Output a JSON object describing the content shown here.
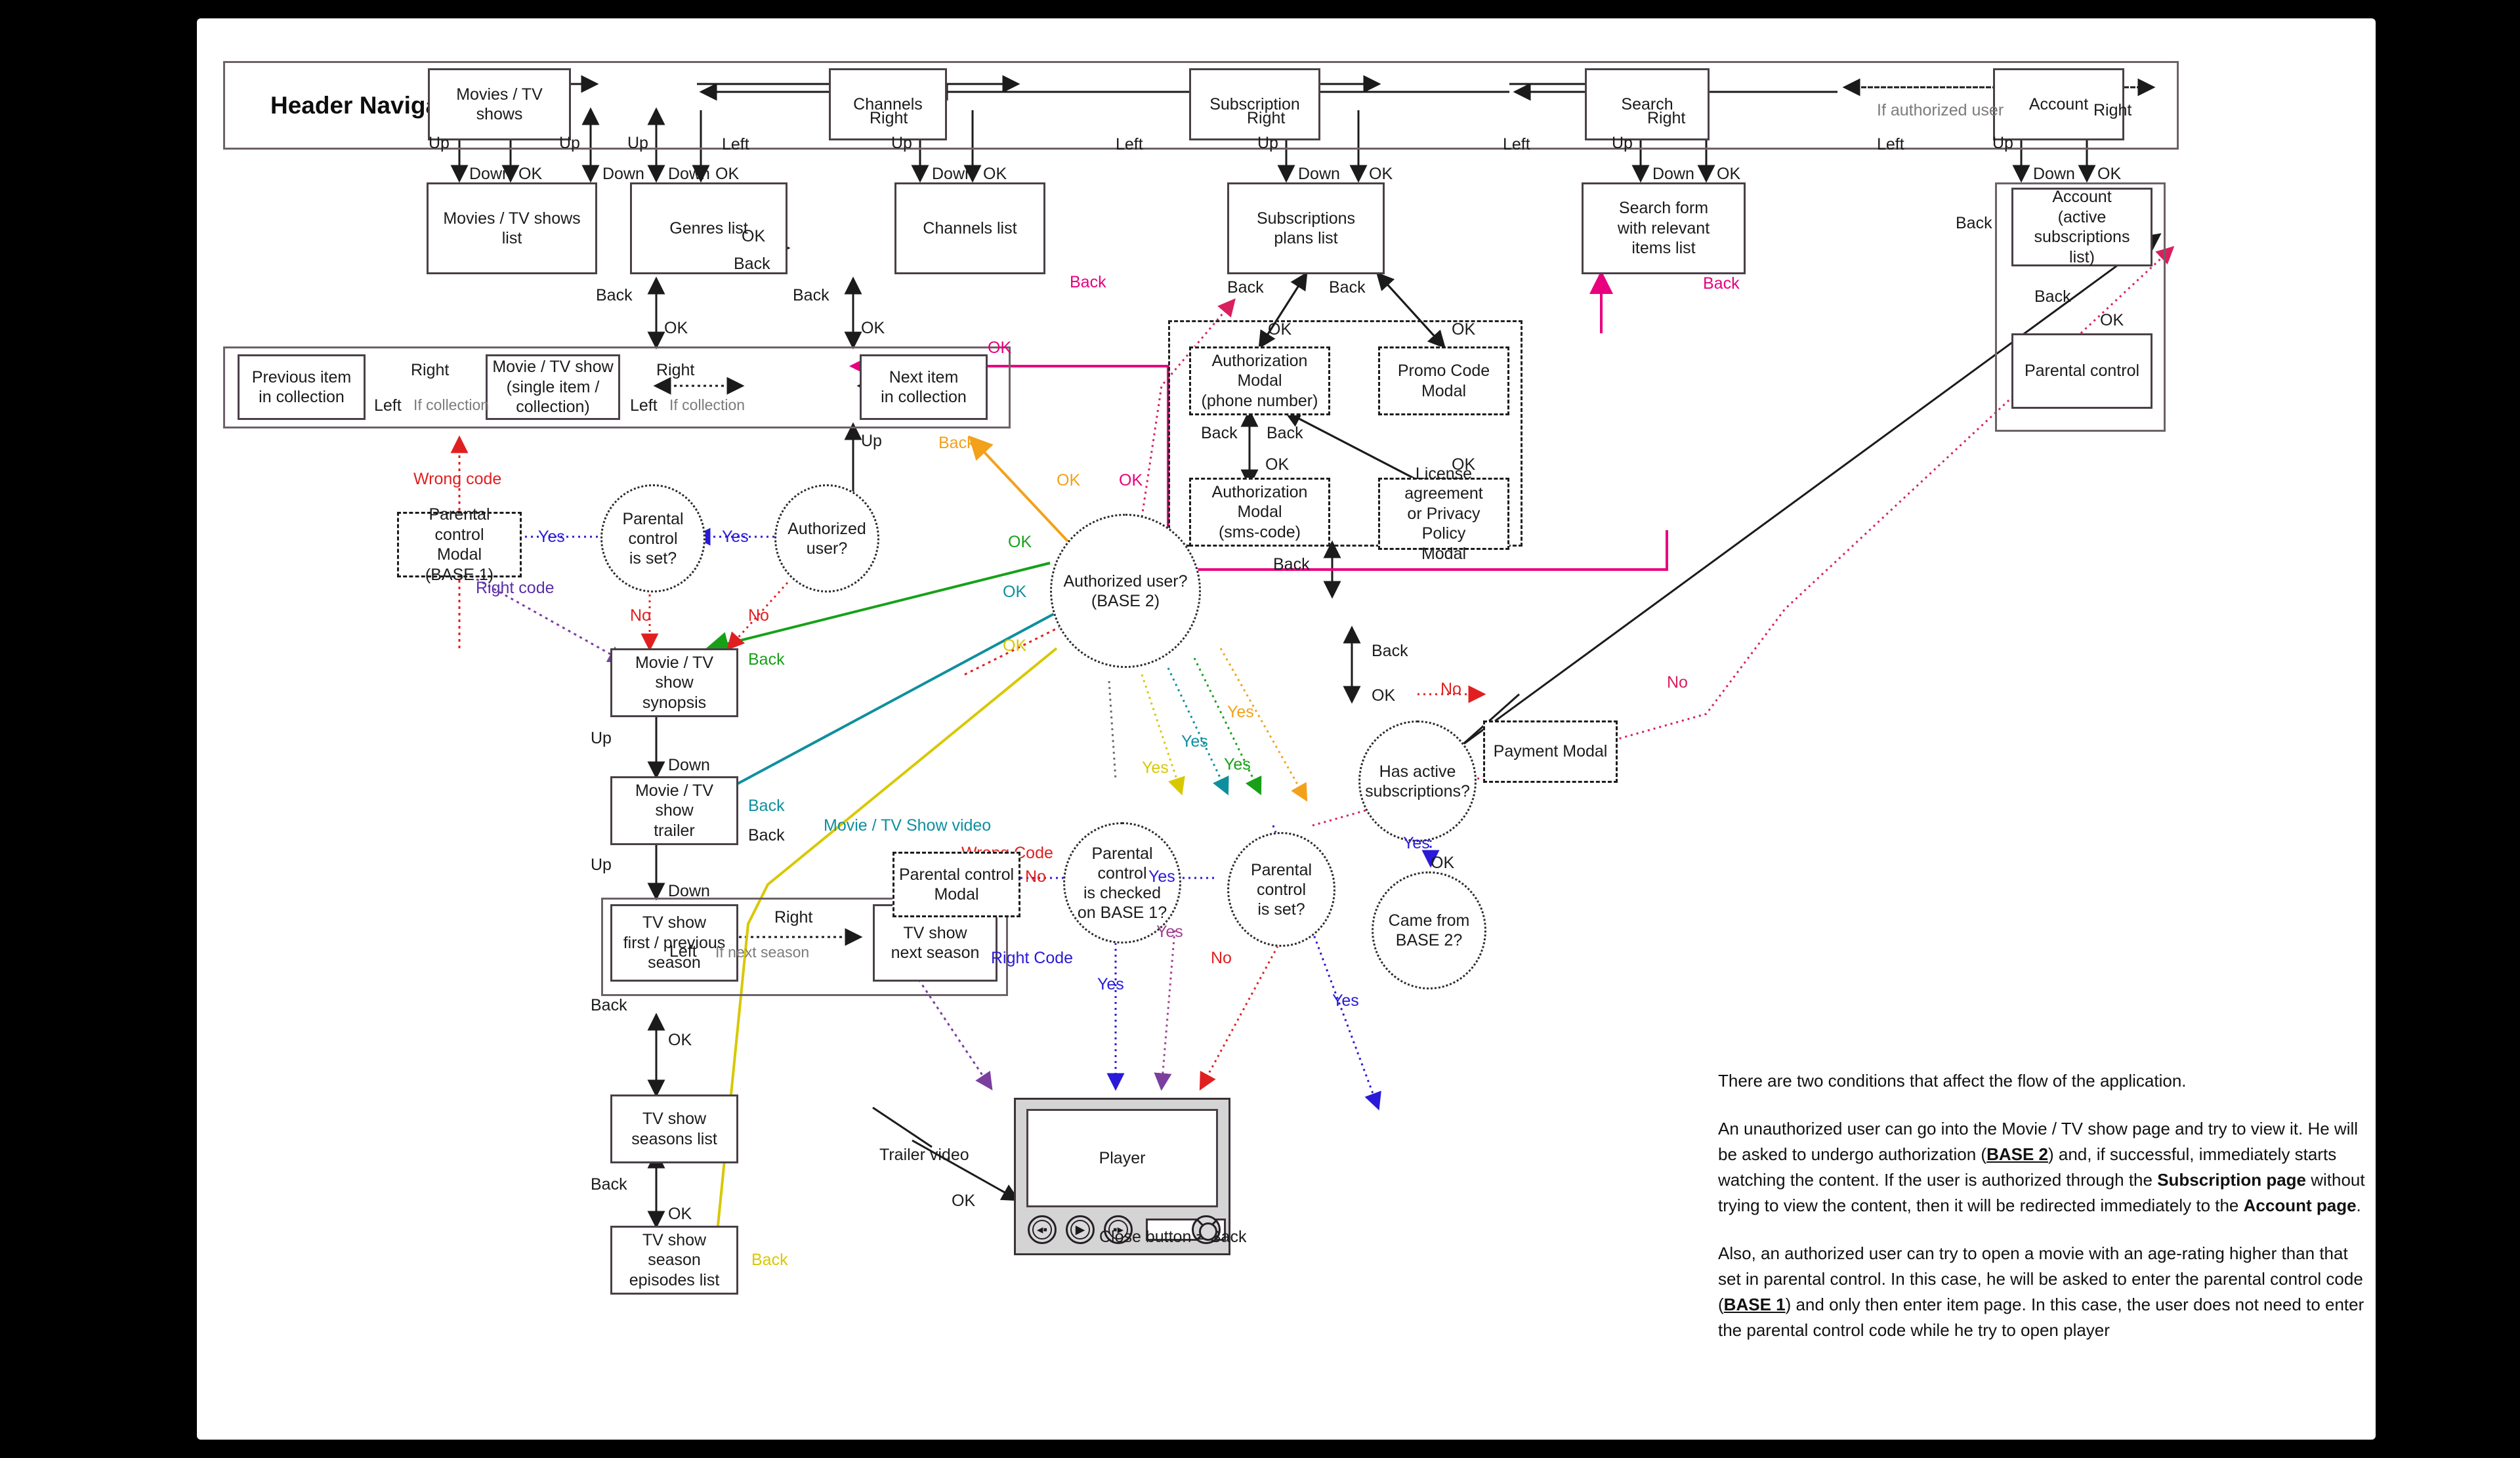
{
  "header": {
    "title": "Header Navigation",
    "items": [
      {
        "label": "Movies / TV shows"
      },
      {
        "label": "Channels"
      },
      {
        "label": "Subscription"
      },
      {
        "label": "Search"
      },
      {
        "label": "Account"
      }
    ]
  },
  "nodes": {
    "movies_list": "Movies / TV shows  list",
    "genres_list": "Genres list",
    "channels_list": "Channels list",
    "subscriptions_plans_list": "Subscriptions\nplans list",
    "search_form": "Search form\nwith relevant\nitems list",
    "account_active": "Account\n(active subscriptions\nlist)",
    "parental_control_page": "Parental control",
    "previous_item": "Previous item\nin collection",
    "movie_single": "Movie / TV show\n(single item /\ncollection)",
    "next_item": "Next item\nin collection",
    "parental_modal_base1": "Parental control\nModal\n(BASE 1)",
    "parental_is_set_top": "Parental control\nis set?",
    "authorized_user_top": "Authorized user?",
    "movie_synopsis": "Movie / TV show\nsynopsis",
    "movie_trailer": "Movie / TV show\ntrailer",
    "tvshow_first_prev": "TV show\nfirst / previous\nseason",
    "tvshow_next_season": "TV show\nnext season",
    "tvshow_seasons_list": "TV show\nseasons list",
    "tvshow_episodes_list": "TV show season\nepisodes list",
    "auth_modal_phone": "Authorization Modal\n(phone number)",
    "promo_code_modal": "Promo Code Modal",
    "auth_modal_sms": "Authorization Modal\n(sms-code)",
    "license_modal": "License agreement\nor Privacy Policy\nModal",
    "authorized_user_base2": "Authorized user?\n(BASE 2)",
    "has_active_subs": "Has active\nsubscriptions?",
    "payment_modal": "Payment Modal",
    "came_from_base2": "Came from\nBASE 2?",
    "parental_modal_mid": "Parental control\nModal",
    "parental_checked_base1": "Parental control\nis checked\non BASE 1?",
    "parental_is_set_mid": "Parental control\nis set?",
    "player": "Player"
  },
  "edge_labels": {
    "right": "Right",
    "left": "Left",
    "up": "Up",
    "down": "Down",
    "ok": "OK",
    "back": "Back",
    "yes": "Yes",
    "no": "No",
    "if_collection": "If collection",
    "if_next_season": "If next season",
    "if_authorized_user": "If authorized user",
    "wrong_code_lower": "Wrong code",
    "wrong_code_upper": "Wrong Code",
    "right_code_lower": "Right code",
    "right_code_upper": "Right Code",
    "movie_tv_show_video": "Movie / TV Show video",
    "trailer_video": "Trailer video",
    "close_button_back": "Close button = Back"
  },
  "player_controls": {
    "rewind": "rewind-button",
    "play": "play-button",
    "forward": "forward-button",
    "seek": "seek-bar",
    "close": "close-button"
  },
  "notes": {
    "p1": "There are two conditions that affect the flow of the application.",
    "p2_a": "An unauthorized user can go into the Movie / TV show page and try to view it. He will be asked to undergo authorization (",
    "p2_base2": "BASE 2",
    "p2_b": ") and, if successful, immediately starts watching the content. If the user is authorized through the ",
    "p2_sub": "Subscription page",
    "p2_c": " without trying to view the content, then it will be redirected immediately to the ",
    "p2_acc": "Account page",
    "p2_d": ".",
    "p3_a": "Also, an authorized user can try to open a movie with an age-rating higher than that set in parental control. In this case, he will be asked to enter the parental control code (",
    "p3_base1": "BASE 1",
    "p3_b": ") and only then enter item page. In this case, the user does not need to enter the parental control code while he try to open player"
  },
  "colors": {
    "magenta": "#e8007d",
    "green": "#17a017",
    "teal": "#0f8f9e",
    "yellow": "#f2e000",
    "orange": "#f3a11a",
    "red": "#e02020",
    "blue": "#2a19d8",
    "purple": "#7b3fa0",
    "crimson": "#d9205e",
    "ink": "#1b1b1b"
  }
}
